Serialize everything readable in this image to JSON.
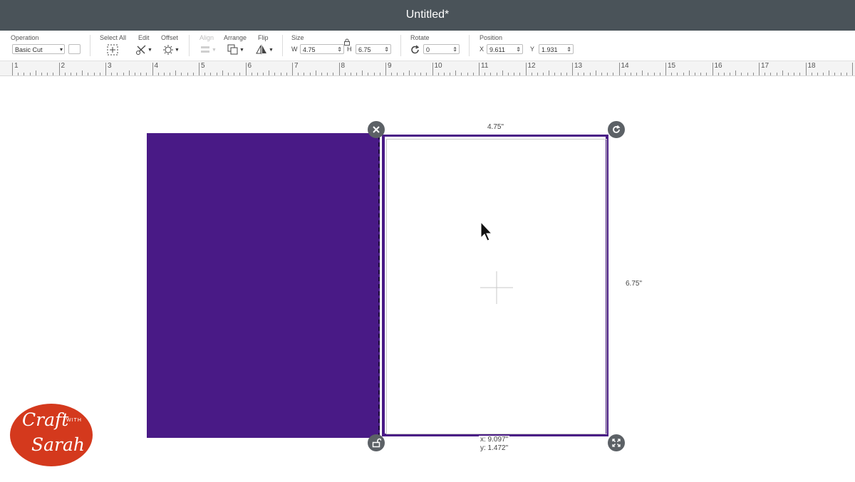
{
  "window": {
    "title": "Untitled*"
  },
  "toolbar": {
    "operation": {
      "label": "Operation",
      "value": "Basic Cut"
    },
    "select_all": {
      "label": "Select All"
    },
    "edit": {
      "label": "Edit"
    },
    "offset": {
      "label": "Offset"
    },
    "align": {
      "label": "Align"
    },
    "arrange": {
      "label": "Arrange"
    },
    "flip": {
      "label": "Flip"
    },
    "size": {
      "label": "Size",
      "w_label": "W",
      "w_value": "4.75",
      "h_label": "H",
      "h_value": "6.75"
    },
    "rotate": {
      "label": "Rotate",
      "value": "0"
    },
    "position": {
      "label": "Position",
      "x_label": "X",
      "x_value": "9.611",
      "y_label": "Y",
      "y_value": "1.931"
    }
  },
  "ruler": {
    "numbers": [
      "1",
      "2",
      "3",
      "4",
      "5",
      "6",
      "7",
      "8",
      "9",
      "10",
      "11",
      "12",
      "13",
      "14",
      "15",
      "16",
      "17",
      "18"
    ]
  },
  "canvas": {
    "width_label": "4.75\"",
    "height_label": "6.75\"",
    "cursor_x": "x: 9.097\"",
    "cursor_y": "y: 1.472\""
  },
  "colors": {
    "shape": "#491a86",
    "titlebar": "#4a5359",
    "handle": "#5c6166",
    "logo": "#d4391d"
  },
  "logo": {
    "line1": "Craft",
    "with": "WITH",
    "line2": "Sarah"
  }
}
